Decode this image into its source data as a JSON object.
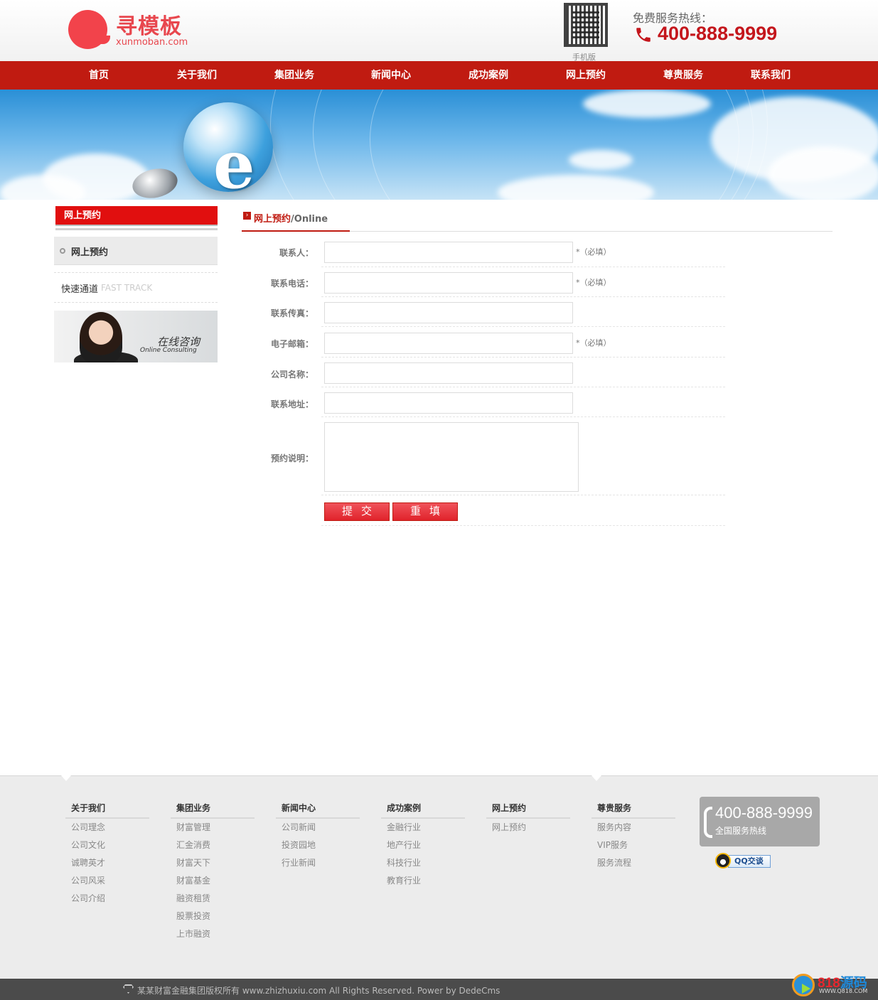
{
  "header": {
    "logo_cn": "寻模板",
    "logo_en": "xunmoban.com",
    "qr_label": "手机版",
    "hotline_label": "免费服务热线：",
    "hotline_number": "400-888-9999"
  },
  "nav": [
    "首页",
    "关于我们",
    "集团业务",
    "新闻中心",
    "成功案例",
    "网上预约",
    "尊贵服务",
    "联系我们"
  ],
  "sidebar": {
    "title": "网上预约",
    "items": [
      "网上预约"
    ],
    "fast_track_label": "快速通道",
    "fast_track_en": "FAST TRACK",
    "consult_cn": "在线咨询",
    "consult_en": "Online Consulting"
  },
  "breadcrumb": {
    "current": "网上预约",
    "suffix": "/Online"
  },
  "form": {
    "fields": [
      {
        "label": "联系人：",
        "required": "*（必填）"
      },
      {
        "label": "联系电话：",
        "required": "*（必填）"
      },
      {
        "label": "联系传真：",
        "required": ""
      },
      {
        "label": "电子邮箱：",
        "required": "*（必填）"
      },
      {
        "label": "公司名称：",
        "required": ""
      },
      {
        "label": "联系地址：",
        "required": ""
      }
    ],
    "textarea_label": "预约说明：",
    "submit": "提交",
    "reset": "重填"
  },
  "footer": {
    "columns": [
      {
        "title": "关于我们",
        "items": [
          "公司理念",
          "公司文化",
          "诚聘英才",
          "公司风采",
          "公司介绍"
        ]
      },
      {
        "title": "集团业务",
        "items": [
          "财富管理",
          "汇金消费",
          "财富天下",
          "财富基金",
          "融资租赁",
          "股票投资",
          "上市融资"
        ]
      },
      {
        "title": "新闻中心",
        "items": [
          "公司新闻",
          "投资园地",
          "行业新闻"
        ]
      },
      {
        "title": "成功案例",
        "items": [
          "金融行业",
          "地产行业",
          "科技行业",
          "教育行业"
        ]
      },
      {
        "title": "网上预约",
        "items": [
          "网上预约"
        ]
      },
      {
        "title": "尊贵服务",
        "items": [
          "服务内容",
          "VIP服务",
          "服务流程"
        ]
      }
    ],
    "phone": "400-888-9999",
    "phone_sub": "全国服务热线",
    "qq_label": "QQ交谈",
    "copyright": "某某财富金融集团版权所有 www.zhizhuxiu.com All Rights Reserved. Power by DedeCms"
  },
  "watermark": {
    "brand_num": "818",
    "brand_cn": "源码",
    "url": "WWW.Q818.COM"
  },
  "colors": {
    "primary_red": "#c01b11",
    "accent_red": "#e10f0f",
    "footer_bg": "#ececec"
  }
}
